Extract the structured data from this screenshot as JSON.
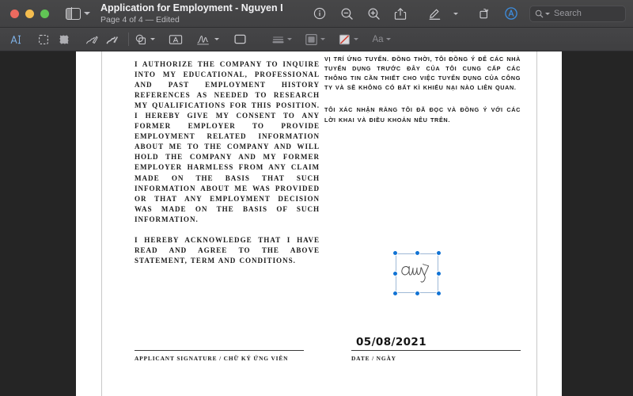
{
  "window": {
    "title": "Application for Employment - Nguyen Le...",
    "subtitle": "Page 4 of 4 — Edited",
    "traffic_lights": [
      "close-red",
      "minimize-yellow",
      "zoom-green"
    ],
    "colors": {
      "close": "#ec6a5f",
      "minimize": "#f4bd4f",
      "zoom": "#61c555",
      "titlebar": "#454547",
      "accent_blue": "#1173d4",
      "active_tool": "#7fb2e8",
      "fill_swatch_red": "#d03a2c"
    }
  },
  "toolbar": {
    "sidebar_toggle": {
      "icon": "sidebar-icon",
      "chevron": "chevron-down-icon"
    },
    "buttons": [
      {
        "name": "info-button",
        "icon": "info-circle-icon"
      },
      {
        "name": "zoom-out-button",
        "icon": "magnifier-minus-icon"
      },
      {
        "name": "zoom-in-button",
        "icon": "magnifier-plus-icon"
      },
      {
        "name": "share-button",
        "icon": "share-upload-icon"
      },
      {
        "name": "markup-button",
        "icon": "markup-pen-icon"
      },
      {
        "name": "markup-options-button",
        "icon": "chevron-down-icon"
      },
      {
        "name": "rotate-button",
        "icon": "rotate-icon"
      },
      {
        "name": "annotate-button",
        "icon": "annotate-circle-a-icon"
      }
    ],
    "search": {
      "placeholder": "Search",
      "value": "",
      "icon": "search-icon"
    }
  },
  "markup_toolbar": {
    "tools": [
      {
        "name": "text-selection-tool",
        "icon": "text-cursor-a-icon",
        "active": true
      },
      {
        "name": "rectangular-selection-tool",
        "icon": "dashed-rectangle-icon",
        "active": false
      },
      {
        "name": "instant-alpha-tool",
        "icon": "filled-selection-icon",
        "active": false
      },
      {
        "name": "sketch-tool",
        "icon": "sketch-squiggle-icon",
        "active": false
      },
      {
        "name": "draw-tool",
        "icon": "draw-squiggle-icon",
        "active": false
      }
    ],
    "inserts": [
      {
        "name": "shapes-tool",
        "icon": "shapes-icon",
        "chevron": true
      },
      {
        "name": "text-box-tool",
        "icon": "text-box-a-icon",
        "chevron": false
      },
      {
        "name": "signature-tool",
        "icon": "signature-icon",
        "chevron": true
      },
      {
        "name": "note-tool",
        "icon": "note-rectangle-icon",
        "chevron": false
      }
    ],
    "styles": [
      {
        "name": "shape-style-button",
        "icon": "line-style-icon",
        "chevron": true,
        "enabled": false
      },
      {
        "name": "border-color-button",
        "icon": "border-color-icon",
        "chevron": true,
        "enabled": false
      },
      {
        "name": "fill-color-button",
        "icon": "fill-color-swatch-icon",
        "chevron": true,
        "enabled": true
      },
      {
        "name": "text-style-button",
        "label": "Aa",
        "chevron": true,
        "enabled": false
      }
    ]
  },
  "document": {
    "paragraphs_en": [
      "I authorize the company to inquire into my educational, professional and past employment history references as needed to research my qualifications for this position. I hereby give my consent to any former employer to provide employment related information about me to the company and will hold the company and my former employer harmless from any claim made on the basis that such information about me was provided or that any employment decision was made on the basis of such information.",
      "I hereby acknowledge that I have read and agree to the above statement, term and conditions."
    ],
    "paragraphs_vi": [
      "tôi để xem xét khả năng thích hợp của tôi đối với vị trí ứng tuyển. Đồng thời, tôi đồng ý để các nhà tuyển dụng trước đây của tôi cung cấp các thông tin cần thiết cho việc tuyển dụng của công ty và sẽ không có bất kì khiếu nại nào liên quan.",
      "Tôi xác nhận rằng tôi đã đọc và đồng ý với các lời khai và điều khoản nêu trên."
    ],
    "signature_block": {
      "applicant_label": "Applicant Signature / Chữ ký ứng viên",
      "date_label": "Date / Ngày",
      "date_value": "05/08/2021"
    },
    "signature_annotation": {
      "name": "signature-annotation",
      "text": "Chuky",
      "selected": true,
      "handles": 8
    }
  }
}
